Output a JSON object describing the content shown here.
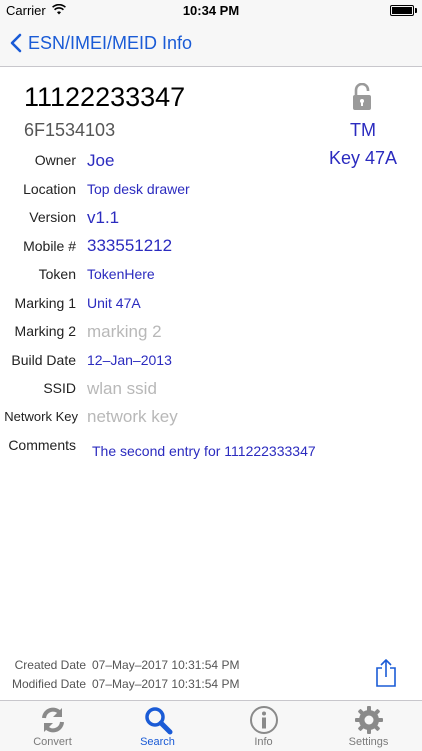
{
  "status_bar": {
    "carrier": "Carrier",
    "time": "10:34 PM"
  },
  "nav": {
    "back_label": "ESN/IMEI/MEID Info"
  },
  "device": {
    "esn": "11122233347",
    "hex": "6F1534103",
    "tm": "TM",
    "key": "Key 47A"
  },
  "fields": [
    {
      "label": "Owner",
      "value": "Joe"
    },
    {
      "label": "Location",
      "value": "Top desk drawer"
    },
    {
      "label": "Version",
      "value": "v1.1"
    },
    {
      "label": "Mobile #",
      "value": "333551212"
    },
    {
      "label": "Token",
      "value": "TokenHere"
    },
    {
      "label": "Marking 1",
      "value": "Unit 47A"
    },
    {
      "label": "Marking 2",
      "placeholder": "marking 2"
    },
    {
      "label": "Build Date",
      "value": "12–Jan–2013"
    },
    {
      "label": "SSID",
      "placeholder": "wlan ssid"
    },
    {
      "label": "Network Key",
      "placeholder": "network key"
    },
    {
      "label": "Comments",
      "value": "The second entry for 111222333347"
    }
  ],
  "dates": {
    "created_label": "Created Date",
    "created_value": "07–May–2017 10:31:54 PM",
    "modified_label": "Modified Date",
    "modified_value": "07–May–2017 10:31:54 PM"
  },
  "tabs": [
    {
      "label": "Convert",
      "icon": "refresh-icon"
    },
    {
      "label": "Search",
      "icon": "search-icon",
      "active": true
    },
    {
      "label": "Info",
      "icon": "info-icon"
    },
    {
      "label": "Settings",
      "icon": "gear-icon"
    }
  ],
  "colors": {
    "accent": "#1a5bd6",
    "value_text": "#2b2bbf",
    "placeholder": "#b8b8b8"
  }
}
